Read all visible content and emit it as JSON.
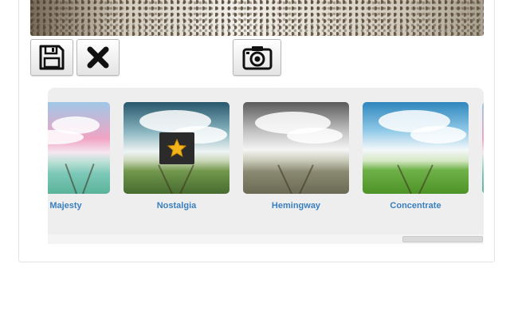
{
  "toolbar": {
    "buttons": [
      {
        "name": "save-button",
        "icon": "floppy-disk-icon"
      },
      {
        "name": "cancel-button",
        "icon": "close-x-icon"
      },
      {
        "name": "camera-button",
        "icon": "camera-icon"
      }
    ]
  },
  "filters": {
    "items": [
      {
        "label": "Majesty",
        "style": "vivid"
      },
      {
        "label": "Nostalgia",
        "style": "teal",
        "badge": "star-icon"
      },
      {
        "label": "Hemingway",
        "style": "gray"
      },
      {
        "label": "Concentrate",
        "style": "vivid"
      }
    ],
    "partial_item_style": "soft"
  },
  "colors": {
    "label_blue": "#3a7fc0",
    "strip_bg": "#eeeeee",
    "star_gold": "#f3b51b"
  }
}
